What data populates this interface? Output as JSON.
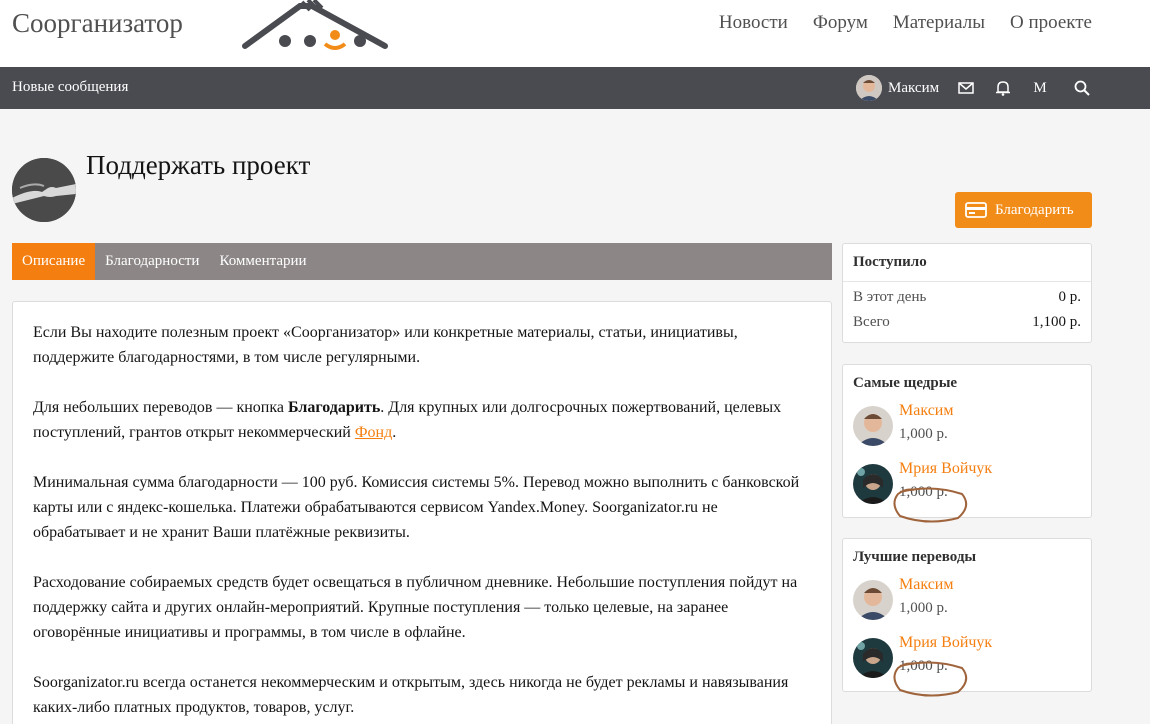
{
  "header": {
    "site_title": "Соорганизатор",
    "nav": [
      "Новости",
      "Форум",
      "Материалы",
      "О проекте"
    ]
  },
  "bar": {
    "new_messages": "Новые сообщения",
    "user_name": "Максим",
    "menu_letter": "M",
    "icons": [
      "envelope-icon",
      "bell-icon",
      "search-icon"
    ]
  },
  "page": {
    "title": "Поддержать проект",
    "thank_button": "Благодарить"
  },
  "tabs": [
    "Описание",
    "Благодарности",
    "Комментарии"
  ],
  "content": {
    "p1": "Если Вы находите полезным проект «Соорганизатор» или конкретные материалы, статьи, инициативы, поддержите благодарностями, в том числе регулярными.",
    "p2_before": "Для небольших переводов — кнопка ",
    "p2_bold": "Благодарить",
    "p2_middle": ". Для крупных или долгосрочных пожертвований, целевых поступлений, грантов открыт некоммерческий ",
    "p2_link": "Фонд",
    "p2_after": ".",
    "p3": "Минимальная сумма благодарности — 100 руб. Комиссия системы 5%. Перевод можно выполнить с банковской карты или с яндекс-кошелька. Платежи обрабатываются сервисом Yandex.Money. Soorganizator.ru не обрабатывает и не хранит Ваши платёжные реквизиты.",
    "p4": "Расходование собираемых средств будет освещаться в публичном дневнике. Небольшие поступления пойдут на поддержку сайта и других онлайн-мероприятий. Крупные поступления — только целевые, на заранее оговорённые инициативы и программы, в том числе в офлайне.",
    "p5": "Soorganizator.ru всегда останется некоммерческим и открытым, здесь никогда не будет рекламы и навязывания каких-либо платных продуктов, товаров, услуг."
  },
  "sidebar": {
    "received": {
      "title": "Поступило",
      "rows": [
        {
          "label": "В этот день",
          "value": "0 р."
        },
        {
          "label": "Всего",
          "value": "1,100 р."
        }
      ]
    },
    "generous": {
      "title": "Самые щедрые",
      "donors": [
        {
          "name": "Максим",
          "amount": "1,000 р."
        },
        {
          "name": "Мрия Войчук",
          "amount": "1,000 р."
        }
      ]
    },
    "best": {
      "title": "Лучшие переводы",
      "donors": [
        {
          "name": "Максим",
          "amount": "1,000 р."
        },
        {
          "name": "Мрия Войчук",
          "amount": "1,000 р."
        }
      ]
    }
  },
  "colors": {
    "accent": "#f47f10",
    "bar": "#4a4b51",
    "tabs": "#8c8687",
    "annotation": "#a0643c"
  }
}
